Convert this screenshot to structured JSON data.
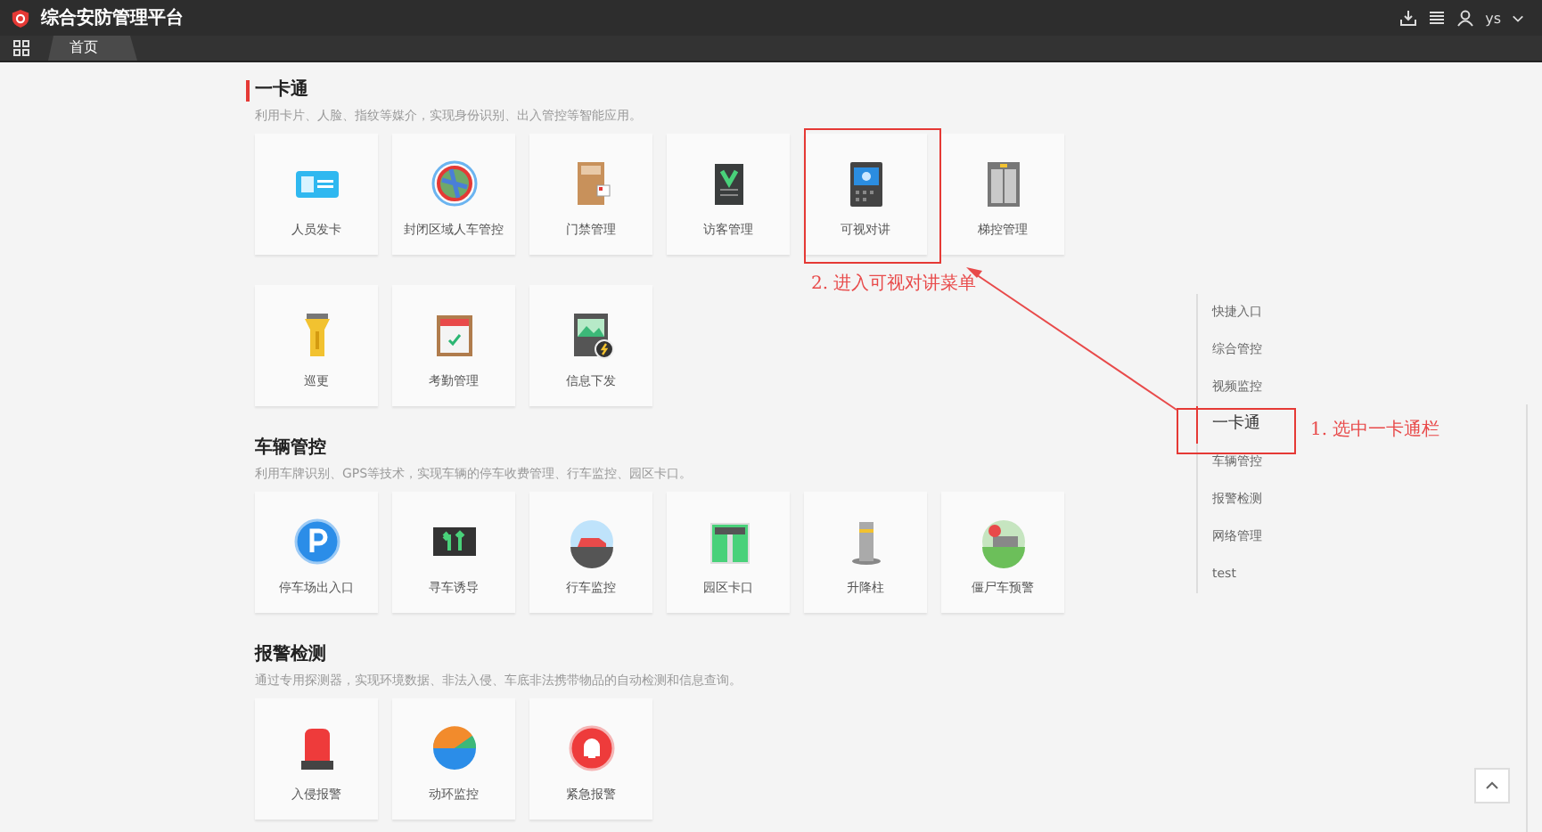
{
  "header": {
    "title": "综合安防管理平台",
    "user": "ys"
  },
  "tabs": [
    {
      "label": "首页",
      "selected": true
    }
  ],
  "sections": [
    {
      "title": "一卡通",
      "description": "利用卡片、人脸、指纹等媒介，实现身份识别、出入管控等智能应用。",
      "selected": true,
      "tiles": [
        {
          "label": "人员发卡"
        },
        {
          "label": "封闭区域人车管控"
        },
        {
          "label": "门禁管理"
        },
        {
          "label": "访客管理"
        },
        {
          "label": "可视对讲"
        },
        {
          "label": "梯控管理"
        },
        {
          "label": "巡更"
        },
        {
          "label": "考勤管理"
        },
        {
          "label": "信息下发"
        }
      ]
    },
    {
      "title": "车辆管控",
      "description": "利用车牌识别、GPS等技术，实现车辆的停车收费管理、行车监控、园区卡口。",
      "selected": false,
      "tiles": [
        {
          "label": "停车场出入口"
        },
        {
          "label": "寻车诱导"
        },
        {
          "label": "行车监控"
        },
        {
          "label": "园区卡口"
        },
        {
          "label": "升降柱"
        },
        {
          "label": "僵尸车预警"
        }
      ]
    },
    {
      "title": "报警检测",
      "description": "通过专用探测器，实现环境数据、非法入侵、车底非法携带物品的自动检测和信息查询。",
      "selected": false,
      "tiles": [
        {
          "label": "入侵报警"
        },
        {
          "label": "动环监控"
        },
        {
          "label": "紧急报警"
        }
      ]
    }
  ],
  "nav": [
    {
      "label": "快捷入口",
      "selected": false
    },
    {
      "label": "综合管控",
      "selected": false
    },
    {
      "label": "视频监控",
      "selected": false
    },
    {
      "label": "一卡通",
      "selected": true
    },
    {
      "label": "车辆管控",
      "selected": false
    },
    {
      "label": "报警检测",
      "selected": false
    },
    {
      "label": "网络管理",
      "selected": false
    },
    {
      "label": "test",
      "selected": false
    }
  ],
  "annotations": [
    {
      "text": "2. 进入可视对讲菜单"
    },
    {
      "text": "1. 选中一卡通栏"
    }
  ]
}
